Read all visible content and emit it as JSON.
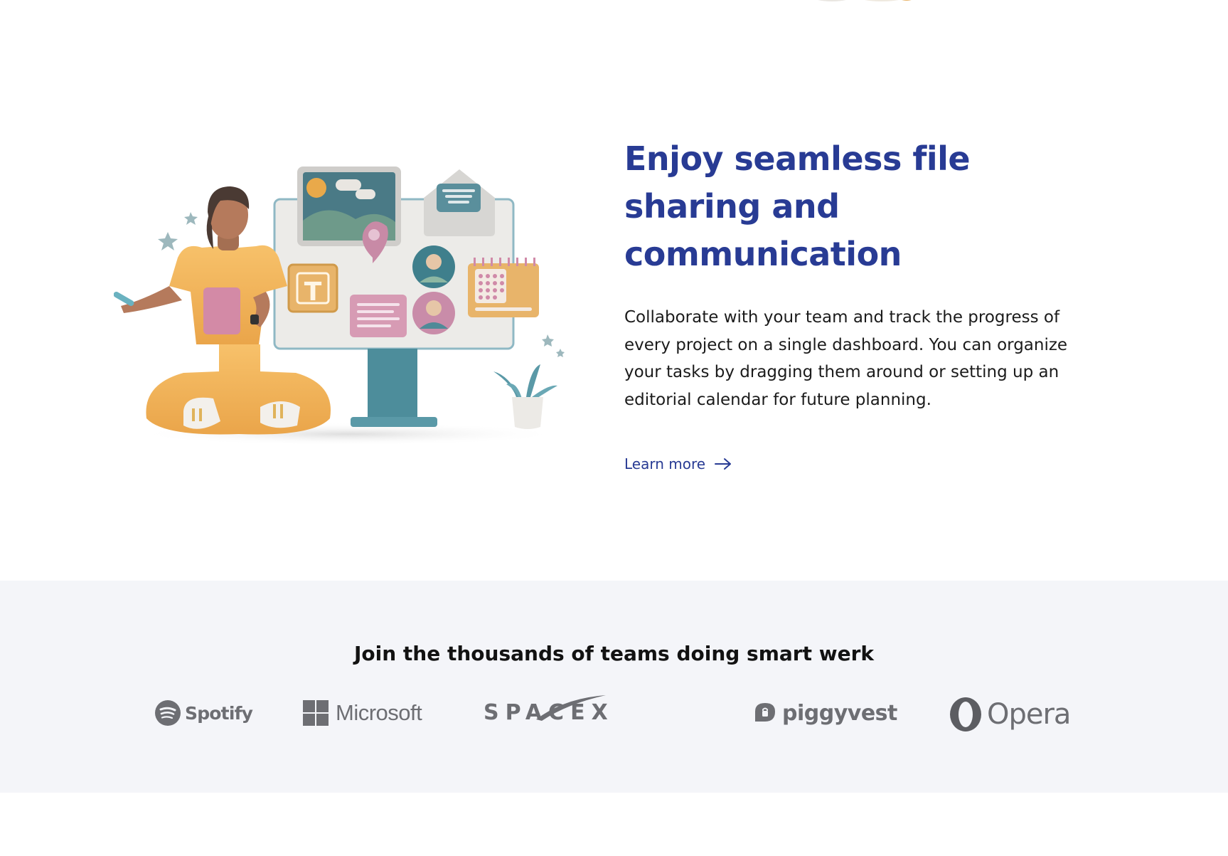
{
  "feature": {
    "headline_lines": [
      "Enjoy seamless file",
      "sharing and",
      "communication"
    ],
    "body": "Collaborate with your team and track the progress of every project on a single dashboard. You can organize your tasks by dragging them around or setting up an editorial calendar for future planning.",
    "learn_more_label": "Learn more",
    "illustration_icon": "person-with-monitor-illustration",
    "colors": {
      "headline": "#283b94",
      "link": "#283b94",
      "body": "#1b1b1b"
    }
  },
  "logos": {
    "title": "Join the thousands of teams doing smart werk",
    "items": [
      {
        "name": "Spotify",
        "icon": "spotify-icon"
      },
      {
        "name": "Microsoft",
        "icon": "microsoft-icon"
      },
      {
        "name": "SPACEX",
        "icon": "spacex-swoosh-icon"
      },
      {
        "name": "piggyvest",
        "icon": "piggyvest-icon"
      },
      {
        "name": "Opera",
        "icon": "opera-icon"
      }
    ],
    "colors": {
      "background": "#f4f5f9",
      "logo": "#6d6e73"
    }
  }
}
